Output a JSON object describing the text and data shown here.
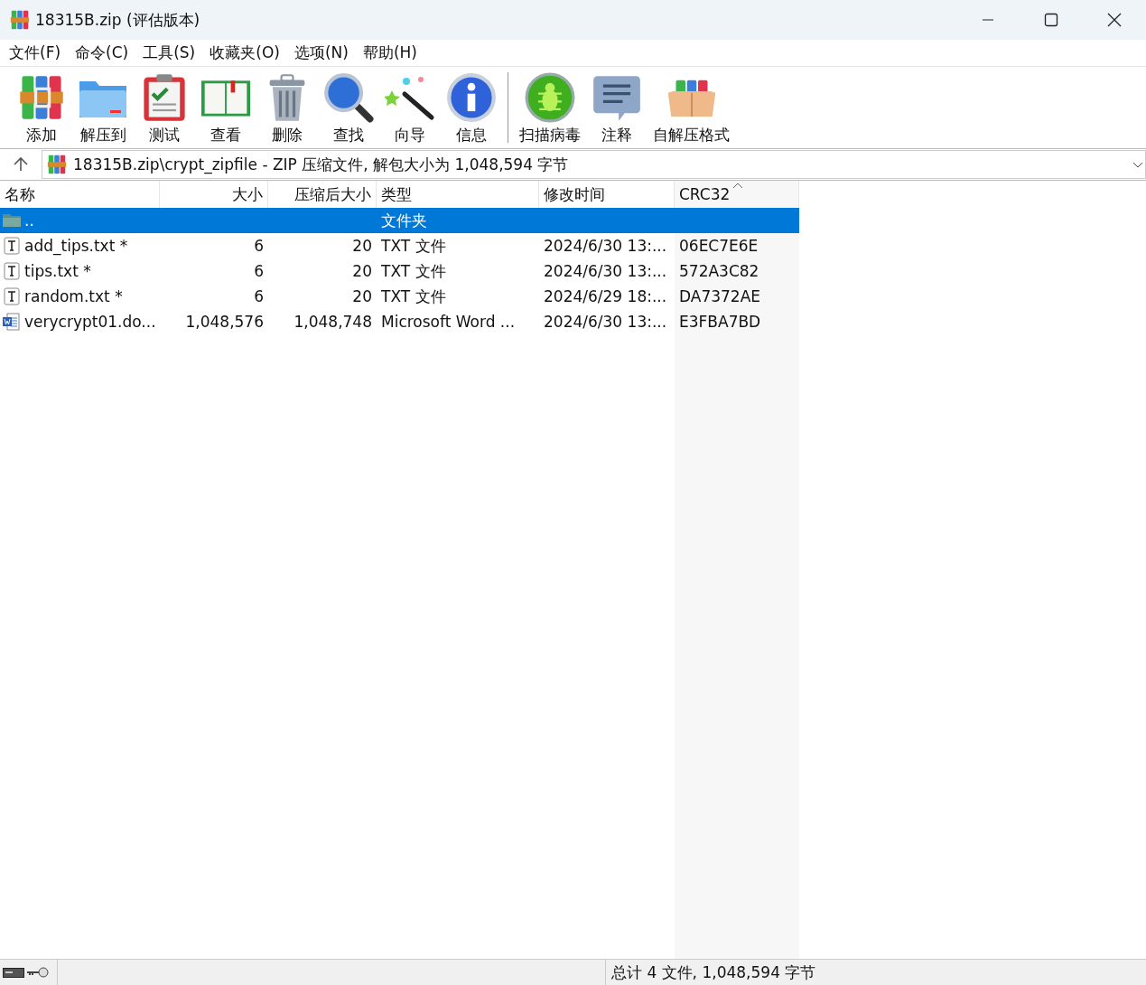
{
  "window": {
    "title": "18315B.zip (评估版本)"
  },
  "menu": [
    "文件(F)",
    "命令(C)",
    "工具(S)",
    "收藏夹(O)",
    "选项(N)",
    "帮助(H)"
  ],
  "toolbar": [
    {
      "label": "添加"
    },
    {
      "label": "解压到"
    },
    {
      "label": "测试"
    },
    {
      "label": "查看"
    },
    {
      "label": "删除"
    },
    {
      "label": "查找"
    },
    {
      "label": "向导"
    },
    {
      "label": "信息"
    },
    {
      "label": "扫描病毒"
    },
    {
      "label": "注释"
    },
    {
      "label": "自解压格式"
    }
  ],
  "address": {
    "path": "18315B.zip\\crypt_zipfile - ZIP 压缩文件, 解包大小为 1,048,594 字节"
  },
  "table": {
    "columns": [
      {
        "label": "名称",
        "sorted": false
      },
      {
        "label": "大小",
        "sorted": false
      },
      {
        "label": "压缩后大小",
        "sorted": false
      },
      {
        "label": "类型",
        "sorted": false
      },
      {
        "label": "修改时间",
        "sorted": false
      },
      {
        "label": "CRC32",
        "sorted": true
      }
    ],
    "rows": [
      {
        "kind": "parent",
        "selected": true,
        "name": "..",
        "size": "",
        "packed": "",
        "type": "文件夹",
        "modified": "",
        "crc": ""
      },
      {
        "kind": "text",
        "selected": false,
        "name": "add_tips.txt *",
        "size": "6",
        "packed": "20",
        "type": "TXT 文件",
        "modified": "2024/6/30 13:...",
        "crc": "06EC7E6E"
      },
      {
        "kind": "text",
        "selected": false,
        "name": "tips.txt *",
        "size": "6",
        "packed": "20",
        "type": "TXT 文件",
        "modified": "2024/6/30 13:...",
        "crc": "572A3C82"
      },
      {
        "kind": "text",
        "selected": false,
        "name": "random.txt *",
        "size": "6",
        "packed": "20",
        "type": "TXT 文件",
        "modified": "2024/6/29 18:...",
        "crc": "DA7372AE"
      },
      {
        "kind": "word",
        "selected": false,
        "name": "verycrypt01.do...",
        "size": "1,048,576",
        "packed": "1,048,748",
        "type": "Microsoft Word ...",
        "modified": "2024/6/30 13:...",
        "crc": "E3FBA7BD"
      }
    ]
  },
  "status_bar": {
    "summary": "总计 4 文件, 1,048,594 字节"
  }
}
